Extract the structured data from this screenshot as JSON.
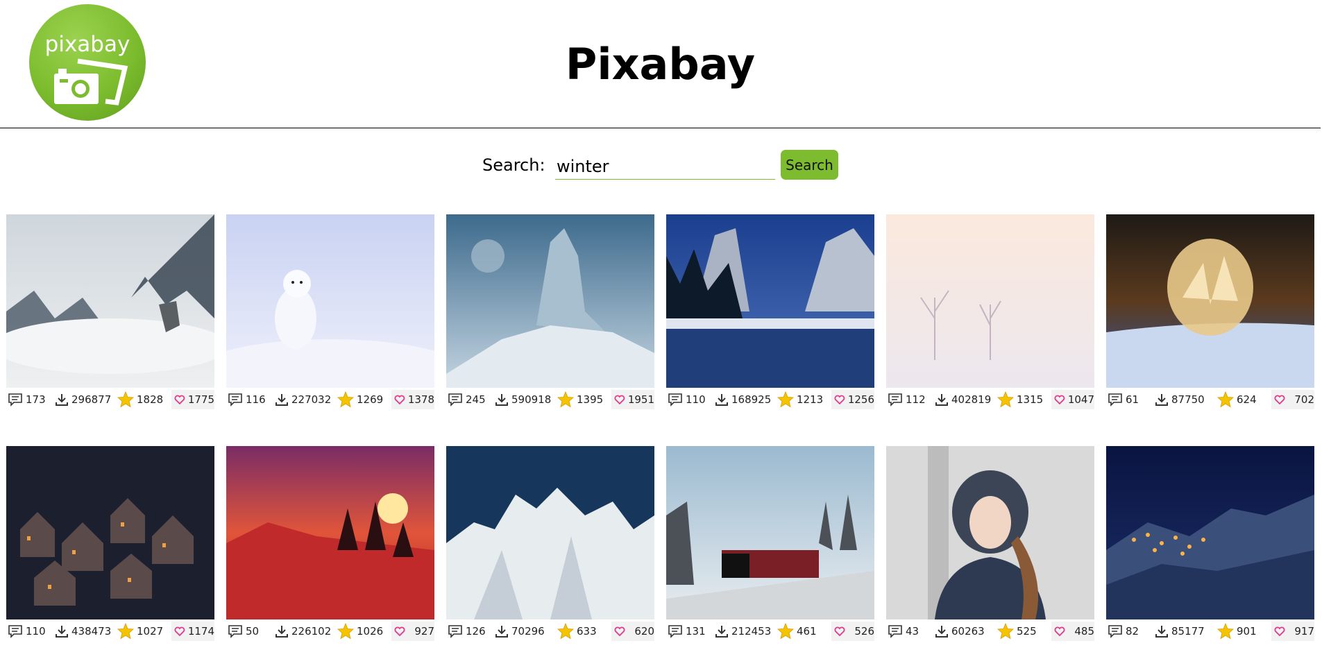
{
  "header": {
    "logo_text": "pixabay",
    "title": "Pixabay"
  },
  "search": {
    "label": "Search:",
    "value": "winter",
    "button_label": "Search"
  },
  "images": [
    {
      "comments": "173",
      "downloads": "296877",
      "favorites": "1828",
      "likes": "1775",
      "scene": "foggy wolf mountains"
    },
    {
      "comments": "116",
      "downloads": "227032",
      "favorites": "1269",
      "likes": "1378",
      "scene": "arctic fox in snow"
    },
    {
      "comments": "245",
      "downloads": "590918",
      "favorites": "1395",
      "likes": "1951",
      "scene": "ice giant fantasy"
    },
    {
      "comments": "110",
      "downloads": "168925",
      "favorites": "1213",
      "likes": "1256",
      "scene": "mountain lake night"
    },
    {
      "comments": "112",
      "downloads": "402819",
      "favorites": "1315",
      "likes": "1047",
      "scene": "misty trees"
    },
    {
      "comments": "61",
      "downloads": "87750",
      "favorites": "624",
      "likes": "702",
      "scene": "frozen bubble"
    },
    {
      "comments": "110",
      "downloads": "438473",
      "favorites": "1027",
      "likes": "1174",
      "scene": "winter village night"
    },
    {
      "comments": "50",
      "downloads": "226102",
      "favorites": "1026",
      "likes": "927",
      "scene": "red sunset snow"
    },
    {
      "comments": "126",
      "downloads": "70296",
      "favorites": "633",
      "likes": "620",
      "scene": "ice crystals"
    },
    {
      "comments": "131",
      "downloads": "212453",
      "favorites": "461",
      "likes": "526",
      "scene": "steam train winter"
    },
    {
      "comments": "43",
      "downloads": "60263",
      "favorites": "525",
      "likes": "485",
      "scene": "woman blowing snow"
    },
    {
      "comments": "82",
      "downloads": "85177",
      "favorites": "901",
      "likes": "917",
      "scene": "mountain village night"
    }
  ],
  "colors": {
    "accent": "#7cbc2e",
    "like_heart": "#e5388b",
    "star": "#f5c400"
  },
  "icons": {
    "comments": "comment-icon",
    "downloads": "download-icon",
    "favorites": "star-icon",
    "likes": "heart-icon"
  }
}
